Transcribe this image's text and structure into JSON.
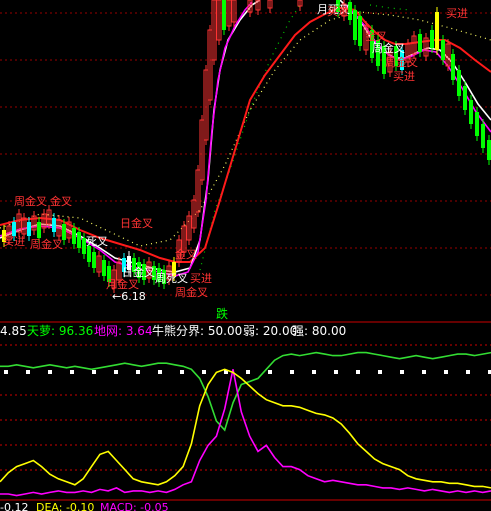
{
  "chart_data": [
    {
      "type": "candlestick",
      "title": "",
      "annotations": {
        "red": [
          "买进",
          "金叉",
          "日金叉",
          "周金叉",
          "月金叉",
          "金叉买进"
        ],
        "white": [
          "周金叉",
          "日金叉",
          "月金叉",
          "←6.18",
          "周死叉"
        ],
        "center_label": "跌"
      },
      "min_price_label": "←6.18",
      "series": [
        {
          "name": "MA-white",
          "color": "#ffffff"
        },
        {
          "name": "MA-magenta",
          "color": "#ff00ff"
        },
        {
          "name": "MA-red",
          "color": "#ff1a1a"
        },
        {
          "name": "MA-dotted",
          "color": "#ffff66"
        },
        {
          "name": "MA-dotted-green",
          "color": "#00cc00"
        }
      ]
    },
    {
      "type": "line",
      "legend": [
        {
          "text": "4.85",
          "color": "#ffffff"
        },
        {
          "text": "天萝: 96.36",
          "color": "#00ff00"
        },
        {
          "text": "地网: 3.64",
          "color": "#ff00ff"
        },
        {
          "text": "牛熊分界: 50.00",
          "color": "#ffffff"
        },
        {
          "text": "弱: 20.00",
          "color": "#ffffff"
        },
        {
          "text": "强: 80.00",
          "color": "#ffffff"
        }
      ],
      "reference_lines": [
        80,
        50,
        20
      ],
      "ylim": [
        0,
        100
      ],
      "series": [
        {
          "name": "天萝",
          "color": "#33dd33",
          "values": [
            86,
            86,
            87,
            86,
            85,
            86,
            87,
            86,
            85,
            86,
            85,
            84,
            85,
            86,
            87,
            88,
            87,
            86,
            87,
            88,
            88,
            87,
            86,
            84,
            78,
            66,
            50,
            44,
            62,
            74,
            76,
            78,
            84,
            90,
            93,
            94,
            93,
            94,
            95,
            94,
            93,
            93,
            94,
            95,
            95,
            94,
            93,
            92,
            91,
            92,
            93,
            92,
            91,
            92,
            93,
            94,
            94,
            93,
            94,
            95
          ]
        },
        {
          "name": "地网",
          "color": "#ff00ff",
          "values": [
            2,
            2,
            1,
            2,
            3,
            2,
            3,
            4,
            3,
            3,
            4,
            3,
            5,
            4,
            6,
            3,
            4,
            4,
            3,
            4,
            3,
            5,
            8,
            10,
            24,
            34,
            40,
            58,
            84,
            56,
            40,
            30,
            34,
            26,
            20,
            20,
            18,
            14,
            12,
            10,
            11,
            10,
            9,
            8,
            8,
            7,
            6,
            6,
            5,
            6,
            5,
            4,
            5,
            4,
            3,
            4,
            3,
            4,
            3,
            4
          ]
        },
        {
          "name": "yellow",
          "color": "#ffff00",
          "values": [
            10,
            16,
            20,
            22,
            24,
            20,
            15,
            12,
            10,
            8,
            12,
            20,
            28,
            30,
            24,
            18,
            12,
            10,
            9,
            8,
            10,
            14,
            20,
            35,
            60,
            74,
            82,
            84,
            82,
            78,
            73,
            68,
            64,
            62,
            60,
            60,
            59,
            57,
            55,
            54,
            52,
            48,
            42,
            35,
            30,
            25,
            22,
            20,
            18,
            14,
            12,
            11,
            10,
            10,
            9,
            9,
            8,
            7,
            7,
            6
          ]
        }
      ]
    },
    {
      "type": "line",
      "legend": [
        {
          "text": "-0.12",
          "color": "#ffffff"
        },
        {
          "text": "DEA: -0.10",
          "color": "#ffff00"
        },
        {
          "text": "MACD: -0.05",
          "color": "#ff00ff"
        }
      ]
    }
  ]
}
